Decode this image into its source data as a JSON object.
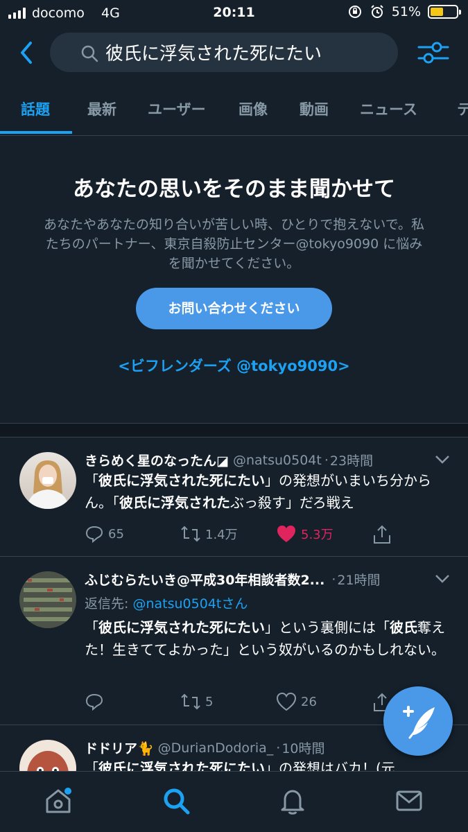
{
  "status_bar": {
    "carrier": "docomo",
    "network": "4G",
    "time": "20:11",
    "battery_percent": "51%",
    "battery_level": 0.51
  },
  "search": {
    "query": "彼氏に浮気された死にたい"
  },
  "tabs": [
    {
      "label": "話題",
      "active": true
    },
    {
      "label": "最新",
      "active": false
    },
    {
      "label": "ユーザー",
      "active": false
    },
    {
      "label": "画像",
      "active": false
    },
    {
      "label": "動画",
      "active": false
    },
    {
      "label": "ニュース",
      "active": false
    },
    {
      "label": "テ",
      "active": false
    }
  ],
  "prompt": {
    "title": "あなたの思いをそのまま聞かせて",
    "body": "あなたやあなたの知り合いが苦しい時、ひとりで抱えないで。私たちのパートナー、東京自殺防止センター@tokyo9090 に悩みを聞かせてください。",
    "button": "お問い合わせください",
    "link": "<ビフレンダーズ @tokyo9090>"
  },
  "tweets": [
    {
      "name": "きらめく星のなったん◪",
      "handle": "@natsu0504t",
      "time": "23時間",
      "body_parts": [
        "「",
        "彼氏に浮気された死にたい",
        "」の発想がいまいち分からん。「",
        "彼氏に浮気された",
        "ぶっ殺す」だろ戦え"
      ],
      "replies": "65",
      "retweets": "1.4万",
      "likes": "5.3万",
      "liked": true
    },
    {
      "name": "ふじむらたいき@平成30年相談者数2...",
      "handle": "",
      "time": "21時間",
      "reply_to_label": "返信先: ",
      "reply_to_handle": "@natsu0504tさん",
      "body_parts": [
        "「",
        "彼氏に浮気された死にたい",
        "」という裏側には「",
        "彼氏",
        "奪えた！生きててよかった」という奴がいるのかもしれない。"
      ],
      "replies": "",
      "retweets": "5",
      "likes": "26",
      "liked": false
    },
    {
      "name": "ドドリア🐈",
      "handle": "@DurianDodoria_",
      "time": "10時間",
      "body_parts": [
        "「",
        "彼氏に浮気された死にたい",
        "」の発想はバカ！(元"
      ]
    }
  ],
  "icons": {
    "back": "chevron-left-icon",
    "search": "search-icon",
    "filter": "sliders-icon",
    "compose": "compose-tweet-icon",
    "nav": [
      "home-icon",
      "search-icon",
      "notifications-icon",
      "messages-icon"
    ]
  },
  "colors": {
    "background": "#15202b",
    "accent": "#1da1f2",
    "like": "#e0245e",
    "muted": "#8899a6"
  }
}
